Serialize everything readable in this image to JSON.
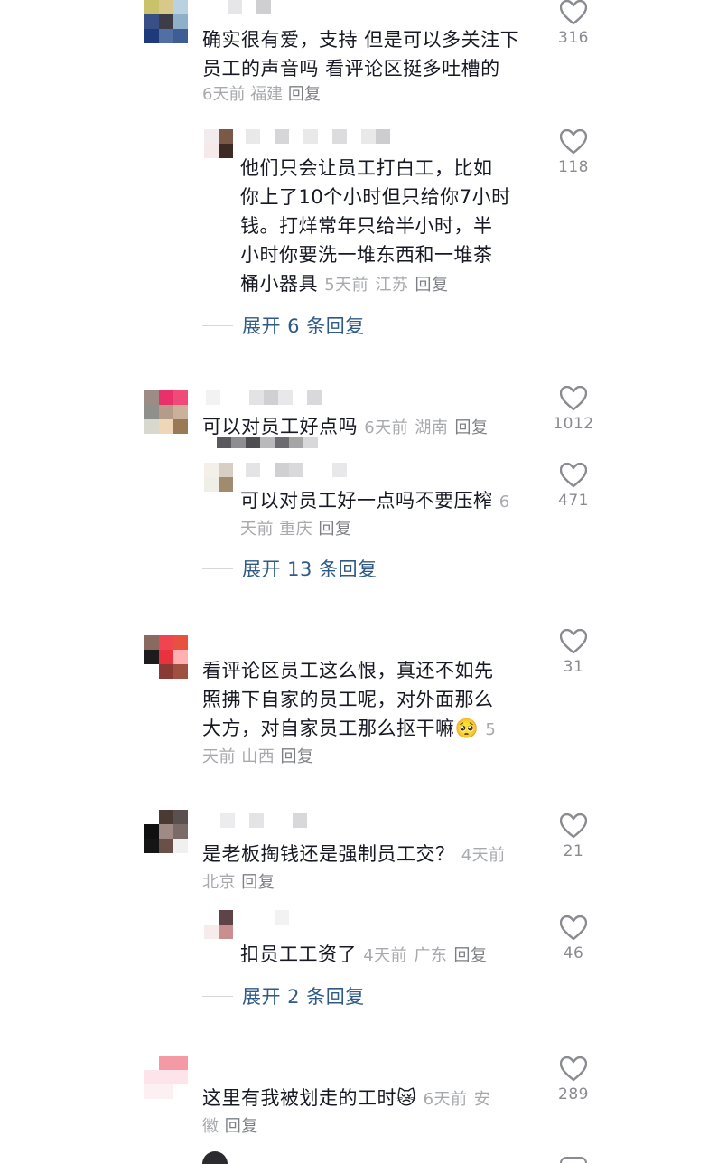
{
  "comments": [
    {
      "text_lines": [
        "确实很有爱，支持 但是可以多关注下",
        "员工的声音吗 看评论区挺多吐槽的"
      ],
      "time": "6天前",
      "location": "福建",
      "reply_label": "回复",
      "likes": "316"
    },
    {
      "text_lines": [
        "他们只会让员工打白工，比如",
        "你上了10个小时但只给你7小时",
        "钱。打烊常年只给半小时，半",
        "小时你要洗一堆东西和一堆茶",
        "桶小器具"
      ],
      "time": "5天前",
      "location": "江苏",
      "reply_label": "回复",
      "likes": "118"
    },
    {
      "expand_label": "展开 6 条回复"
    },
    {
      "text_lines": [
        "可以对员工好点吗"
      ],
      "time": "6天前",
      "location": "湖南",
      "reply_label": "回复",
      "likes": "1012"
    },
    {
      "text_lines": [
        "可以对员工好一点吗不要压榨"
      ],
      "time_a": "6",
      "time_b": "天前",
      "location": "重庆",
      "reply_label": "回复",
      "likes": "471"
    },
    {
      "expand_label": "展开 13 条回复"
    },
    {
      "text_lines": [
        "看评论区员工这么恨，真还不如先",
        "照拂下自家的员工呢，对外面那么",
        "大方，对自家员工那么抠干嘛"
      ],
      "time_a": "5",
      "time_b": "天前",
      "location": "山西",
      "reply_label": "回复",
      "likes": "31"
    },
    {
      "text_lines": [
        "是老板掏钱还是强制员工交？"
      ],
      "time": "4天前",
      "location": "北京",
      "reply_label": "回复",
      "likes": "21"
    },
    {
      "text_lines": [
        "扣员工工资了"
      ],
      "time": "4天前",
      "location": "广东",
      "reply_label": "回复",
      "likes": "46"
    },
    {
      "expand_label": "展开 2 条回复"
    },
    {
      "text_lines": [
        "这里有我被划走的工时"
      ],
      "time": "6天前",
      "location_a": "安",
      "location_b": "徽",
      "reply_label": "回复",
      "likes": "289"
    }
  ],
  "emoji": {
    "crying": "🥺",
    "cat": "😿"
  },
  "colors": {
    "text": "#161823",
    "meta": "#a7a9ad",
    "expand": "#2f5a85",
    "heart": "#8a8b91"
  }
}
